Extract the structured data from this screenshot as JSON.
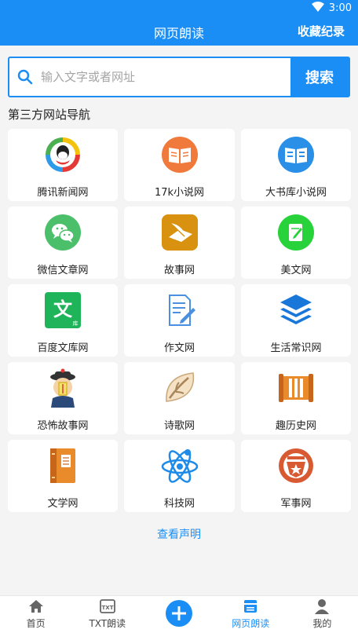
{
  "status": {
    "time": "3:00"
  },
  "header": {
    "title": "网页朗读",
    "action": "收藏纪录"
  },
  "search": {
    "placeholder": "输入文字或者网址",
    "button": "搜索"
  },
  "section_title": "第三方网站导航",
  "sites": [
    {
      "label": "腾讯新闻网",
      "icon": "tencent-news-icon"
    },
    {
      "label": "17k小说网",
      "icon": "open-book-icon"
    },
    {
      "label": "大书库小说网",
      "icon": "book-library-icon"
    },
    {
      "label": "微信文章网",
      "icon": "wechat-icon"
    },
    {
      "label": "故事网",
      "icon": "story-quill-icon"
    },
    {
      "label": "美文网",
      "icon": "notebook-pen-icon"
    },
    {
      "label": "百度文库网",
      "icon": "baidu-wenku-icon"
    },
    {
      "label": "作文网",
      "icon": "document-pen-icon"
    },
    {
      "label": "生活常识网",
      "icon": "stack-layers-icon"
    },
    {
      "label": "恐怖故事网",
      "icon": "qing-official-icon"
    },
    {
      "label": "诗歌网",
      "icon": "poetry-leaf-icon"
    },
    {
      "label": "趣历史网",
      "icon": "scroll-icon"
    },
    {
      "label": "文学网",
      "icon": "literature-book-icon"
    },
    {
      "label": "科技网",
      "icon": "atom-icon"
    },
    {
      "label": "军事网",
      "icon": "military-badge-icon"
    }
  ],
  "notice": "查看声明",
  "nav": [
    {
      "label": "首页",
      "icon": "home-icon"
    },
    {
      "label": "TXT朗读",
      "icon": "txt-file-icon"
    },
    {
      "label": "",
      "icon": "plus-circle-icon"
    },
    {
      "label": "网页朗读",
      "icon": "web-page-icon"
    },
    {
      "label": "我的",
      "icon": "user-icon"
    }
  ],
  "colors": {
    "primary": "#1b8ef5",
    "background": "#f4f4f4"
  }
}
